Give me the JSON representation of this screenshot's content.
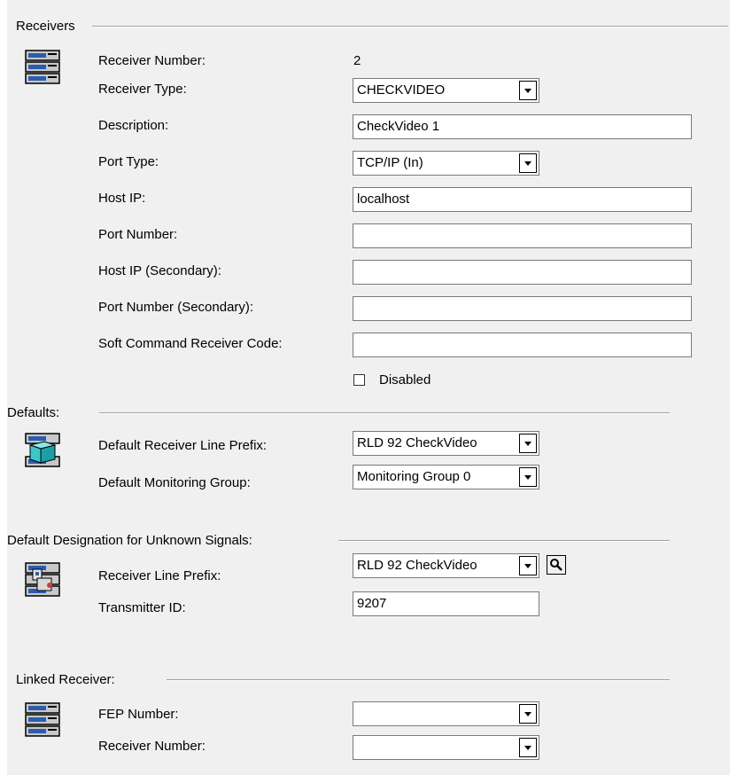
{
  "receivers": {
    "group_title": "Receivers",
    "receiver_number_label": "Receiver Number:",
    "receiver_number_value": "2",
    "receiver_type_label": "Receiver Type:",
    "receiver_type_value": "CHECKVIDEO",
    "description_label": "Description:",
    "description_value": "CheckVideo 1",
    "port_type_label": "Port Type:",
    "port_type_value": "TCP/IP (In)",
    "host_ip_label": "Host IP:",
    "host_ip_value": "localhost",
    "port_number_label": "Port Number:",
    "port_number_value": "",
    "host_ip_secondary_label": "Host IP (Secondary):",
    "host_ip_secondary_value": "",
    "port_number_secondary_label": "Port Number (Secondary):",
    "port_number_secondary_value": "",
    "soft_command_label": "Soft Command Receiver Code:",
    "soft_command_value": "",
    "disabled_label": "Disabled",
    "disabled_checked": false
  },
  "defaults": {
    "group_title": "Defaults:",
    "line_prefix_label": "Default Receiver Line Prefix:",
    "line_prefix_value": "RLD 92 CheckVideo",
    "monitoring_group_label": "Default Monitoring Group:",
    "monitoring_group_value": "Monitoring Group 0"
  },
  "unknown_signals": {
    "group_title": "Default Designation for Unknown Signals:",
    "line_prefix_label": "Receiver Line Prefix:",
    "line_prefix_value": "RLD 92 CheckVideo",
    "transmitter_id_label": "Transmitter ID:",
    "transmitter_id_value": "9207"
  },
  "linked_receiver": {
    "group_title": "Linked Receiver:",
    "fep_number_label": "FEP Number:",
    "fep_number_value": "",
    "receiver_number_label": "Receiver Number:",
    "receiver_number_value": ""
  },
  "icons": {
    "receivers": "server-rack-icon",
    "defaults": "server-package-icon",
    "unknown_signals": "server-locked-icon",
    "linked_receiver": "server-rack-icon"
  },
  "colors": {
    "panel_bg": "#f0f0f0",
    "field_border": "#7a7a7a",
    "icon_blue": "#2a5db0",
    "icon_teal": "#3cc7c9"
  }
}
